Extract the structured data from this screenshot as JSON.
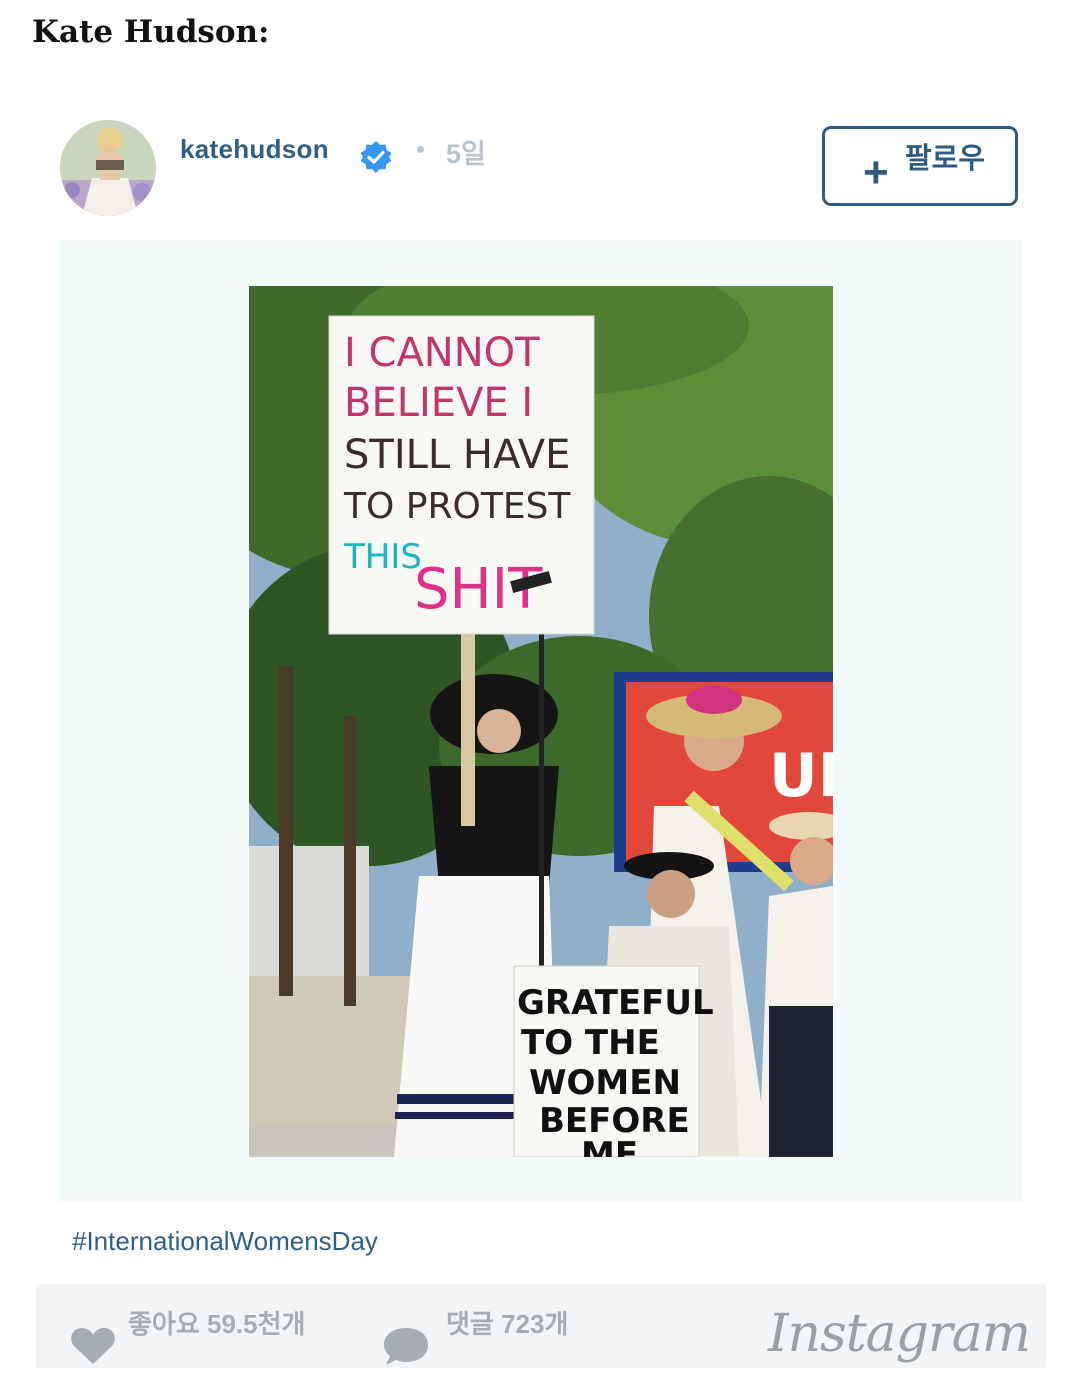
{
  "heading": "Kate Hudson:",
  "post": {
    "username": "katehudson",
    "age": "5일",
    "follow_label": "팔로우",
    "follow_icon": "plus-icon",
    "verified_icon": "verified-badge-icon",
    "photo": {
      "sign_lines": [
        "I CANNOT",
        "BELIEVE I",
        "STILL HAVE",
        "TO PROTEST",
        "THIS",
        "SHIT"
      ],
      "banner_lines": [
        "GRATEFUL",
        "TO THE",
        "WOMEN",
        "BEFORE",
        "ME"
      ],
      "backdrop_text": "UNI"
    },
    "caption": "#InternationalWomensDay",
    "footer": {
      "likes": "좋아요 59.5천개",
      "comments": "댓글 723개",
      "brand": "Instagram",
      "like_icon": "heart-icon",
      "comment_icon": "comment-bubble-icon"
    }
  },
  "colors": {
    "link_blue": "#2f5f87",
    "verified_blue": "#3897f0",
    "muted_gray": "#b9c3cc",
    "footer_bg": "#f2f4f5",
    "media_bg": "#f3fcfb"
  }
}
